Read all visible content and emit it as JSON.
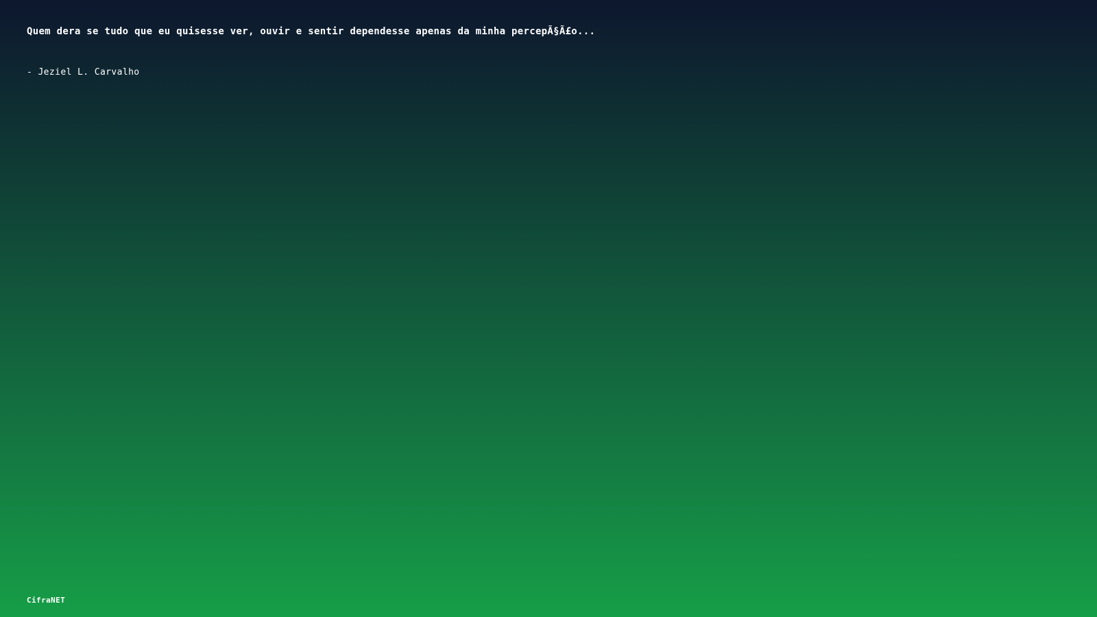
{
  "quote": {
    "text": "Quem dera se tudo que eu quisesse ver, ouvir e sentir dependesse apenas da minha percepÃ§Ã£o...",
    "author": "- Jeziel L. Carvalho"
  },
  "footer": {
    "brand": "CifraNET"
  },
  "colors": {
    "gradient_top": "#0d172e",
    "gradient_bottom": "#169e47",
    "text": "#ffffff"
  }
}
